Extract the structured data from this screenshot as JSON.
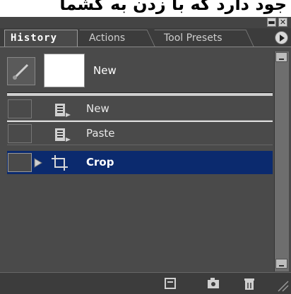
{
  "overlay_text": "جود دارد که با زدن به کشما",
  "window": {
    "minimize_symbol": "▬",
    "close_symbol": "✕"
  },
  "tabs": [
    {
      "label": "History",
      "active": true
    },
    {
      "label": "Actions",
      "active": false
    },
    {
      "label": "Tool Presets",
      "active": false
    }
  ],
  "snapshot": {
    "label": "New"
  },
  "history_items": [
    {
      "label": "New",
      "icon": "document-icon",
      "selected": false
    },
    {
      "label": "Paste",
      "icon": "document-icon",
      "selected": false
    },
    {
      "label": "Crop",
      "icon": "crop-icon",
      "selected": true
    }
  ],
  "colors": {
    "panel_bg": "#4a4a4a",
    "selection": "#0b2a6e"
  },
  "footer_icons": [
    "new-document-from-state-icon",
    "new-snapshot-icon",
    "trash-icon"
  ]
}
